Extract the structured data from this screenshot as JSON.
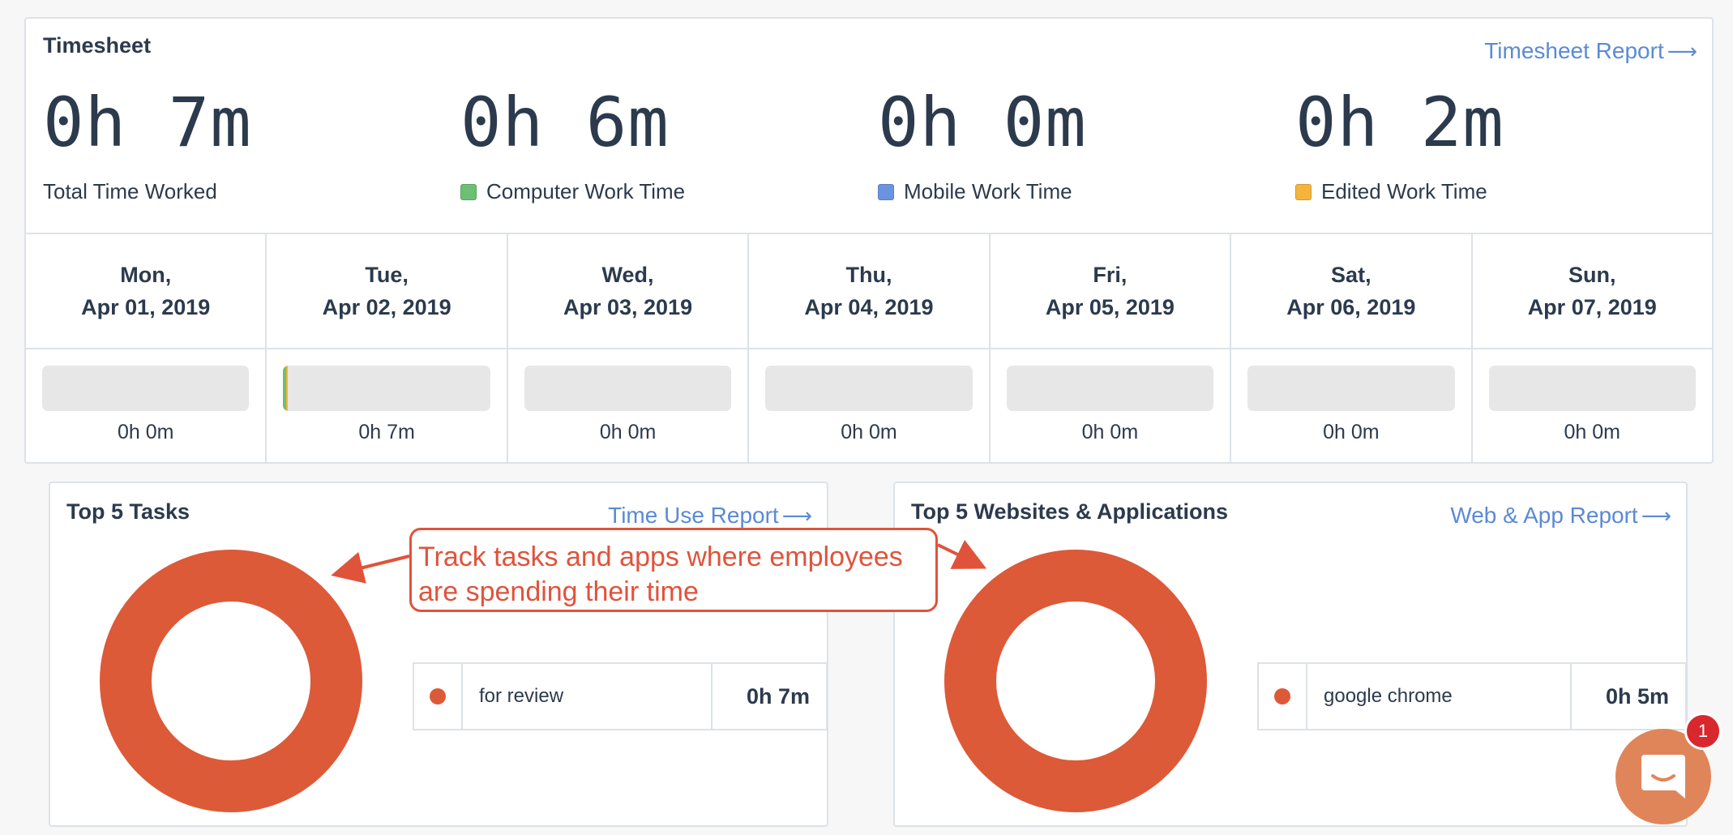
{
  "timesheet": {
    "title": "Timesheet",
    "report_link": "Timesheet Report",
    "stats": [
      {
        "value": "0h 7m",
        "label": "Total Time Worked",
        "color": ""
      },
      {
        "value": "0h 6m",
        "label": "Computer Work Time",
        "color": "#6cbf73"
      },
      {
        "value": "0h 0m",
        "label": "Mobile Work Time",
        "color": "#6b94e0"
      },
      {
        "value": "0h 2m",
        "label": "Edited Work Time",
        "color": "#f5b43c"
      }
    ],
    "days": [
      {
        "weekday": "Mon,",
        "date": "Apr 01, 2019",
        "total": "0h 0m",
        "fill_fraction": 0
      },
      {
        "weekday": "Tue,",
        "date": "Apr 02, 2019",
        "total": "0h 7m",
        "fill_fraction": 0.02
      },
      {
        "weekday": "Wed,",
        "date": "Apr 03, 2019",
        "total": "0h 0m",
        "fill_fraction": 0
      },
      {
        "weekday": "Thu,",
        "date": "Apr 04, 2019",
        "total": "0h 0m",
        "fill_fraction": 0
      },
      {
        "weekday": "Fri,",
        "date": "Apr 05, 2019",
        "total": "0h 0m",
        "fill_fraction": 0
      },
      {
        "weekday": "Sat,",
        "date": "Apr 06, 2019",
        "total": "0h 0m",
        "fill_fraction": 0
      },
      {
        "weekday": "Sun,",
        "date": "Apr 07, 2019",
        "total": "0h 0m",
        "fill_fraction": 0
      }
    ]
  },
  "top_tasks": {
    "title": "Top 5 Tasks",
    "report_link": "Time Use Report",
    "items": [
      {
        "name": "for review",
        "time": "0h 7m",
        "color": "#dc5a38"
      }
    ]
  },
  "top_apps": {
    "title": "Top 5 Websites & Applications",
    "report_link": "Web & App Report",
    "items": [
      {
        "name": "google chrome",
        "time": "0h 5m",
        "color": "#dc5a38"
      }
    ]
  },
  "annotation": {
    "line1": "Track tasks and apps where employees",
    "line2": "are spending their time"
  },
  "chat": {
    "badge_count": "1"
  },
  "colors": {
    "accent": "#5b8ad6",
    "donut": "#dc5a38",
    "annotation": "#e0533b"
  }
}
